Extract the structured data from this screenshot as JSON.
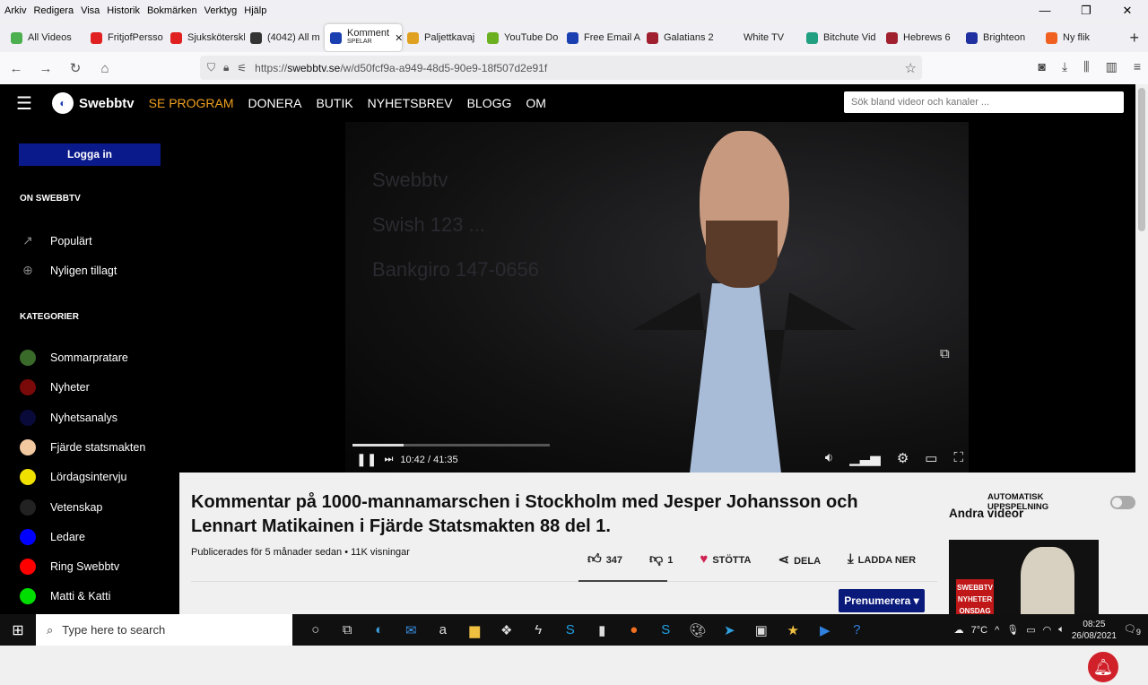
{
  "menubar": [
    "Arkiv",
    "Redigera",
    "Visa",
    "Historik",
    "Bokmärken",
    "Verktyg",
    "Hjälp"
  ],
  "tabs": [
    {
      "label": "All Videos",
      "color": "#4caf50"
    },
    {
      "label": "FritjofPersso",
      "color": "#e02020"
    },
    {
      "label": "Sjuksköterskl",
      "color": "#e02020"
    },
    {
      "label": "(4042) All m",
      "color": "#333333"
    },
    {
      "label": "Komment",
      "sublabel": "SPELAR",
      "color": "#1a3fb0",
      "active": true
    },
    {
      "label": "Paljettkavaj",
      "color": "#e0a020"
    },
    {
      "label": "YouTube Do",
      "color": "#6ab020"
    },
    {
      "label": "Free Email A",
      "color": "#1a3fb0"
    },
    {
      "label": "Galatians 2",
      "color": "#a02030"
    },
    {
      "label": "White TV",
      "color": "transparent"
    },
    {
      "label": "Bitchute Vid",
      "color": "#20a080"
    },
    {
      "label": "Hebrews 6",
      "color": "#a02030"
    },
    {
      "label": "Brighteon",
      "color": "#2030a0"
    },
    {
      "label": "Ny flik",
      "color": "#f06020"
    }
  ],
  "url": {
    "prefix": "https://",
    "domain": "swebbtv.se",
    "path": "/w/d50fcf9a-a949-48d5-90e9-18f507d2e91f"
  },
  "site": {
    "logo": "Swebbtv",
    "nav": [
      "SE PROGRAM",
      "DONERA",
      "BUTIK",
      "NYHETSBREV",
      "BLOGG",
      "OM"
    ],
    "search_placeholder": "Sök bland videor och kanaler ...",
    "login": "Logga in",
    "on_heading": "ON SWEBBTV",
    "on_items": [
      "Populärt",
      "Nyligen tillagt"
    ],
    "cat_heading": "KATEGORIER",
    "categories": [
      {
        "label": "Sommarpratare",
        "color": "#3a6a2a"
      },
      {
        "label": "Nyheter",
        "color": "#7a0a0a"
      },
      {
        "label": "Nyhetsanalys",
        "color": "#0a0a3a"
      },
      {
        "label": "Fjärde statsmakten",
        "color": "#f2c8a0"
      },
      {
        "label": "Lördagsintervju",
        "color": "#f0e000"
      },
      {
        "label": "Vetenskap",
        "color": "#222222"
      },
      {
        "label": "Ledare",
        "color": "#0000ff"
      },
      {
        "label": "Ring Swebbtv",
        "color": "#ff0000"
      },
      {
        "label": "Matti & Katti",
        "color": "#00dd00"
      }
    ]
  },
  "player": {
    "time": "10:42 / 41:35",
    "progress": 0.26,
    "bgtext": [
      "Swebbtv",
      "Swish 123 ...",
      "Bankgiro 147-0656"
    ]
  },
  "video": {
    "title": "Kommentar på 1000-mannamarschen i Stockholm med Jesper Johansson och Lennart Matikainen i Fjärde Statsmakten 88 del 1.",
    "meta": "Publicerades för 5 månader sedan • 11K visningar",
    "likes": "347",
    "dislikes": "1",
    "support": "STÖTTA",
    "share": "DELA",
    "download": "LADDA NER",
    "subscribe": "Prenumerera ▾"
  },
  "sidepanel": {
    "autoplay": "AUTOMATISK UPPSPELNING",
    "heading": "Andra videor",
    "thumb_tag": "SWEBBTV NYHETER ONSDAG"
  },
  "taskbar": {
    "search": "Type here to search",
    "weather": "7°C",
    "time": "08:25",
    "date": "26/08/2021",
    "notifications": "9"
  }
}
